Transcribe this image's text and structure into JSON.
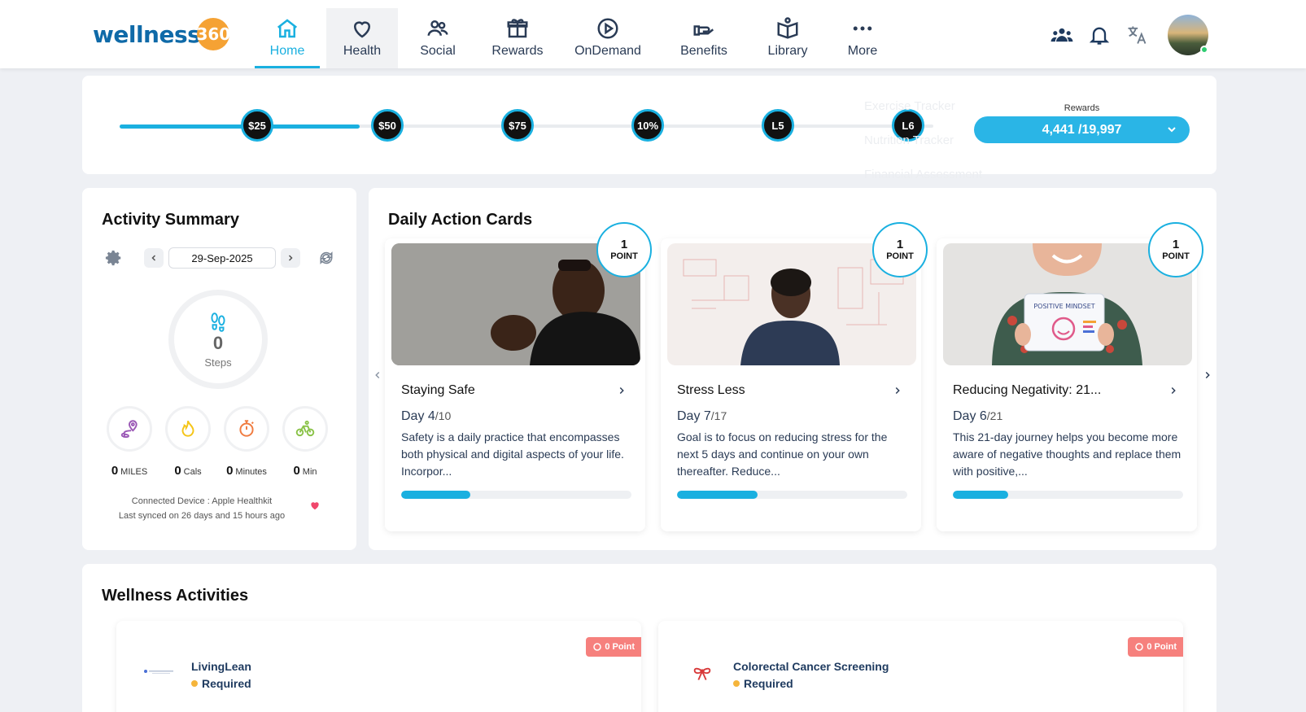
{
  "brand": {
    "name": "wellness",
    "number": "360"
  },
  "nav": {
    "items": [
      {
        "label": "Home",
        "icon": "home-icon"
      },
      {
        "label": "Health",
        "icon": "heart-icon"
      },
      {
        "label": "Social",
        "icon": "people-icon"
      },
      {
        "label": "Rewards",
        "icon": "gift-icon"
      },
      {
        "label": "OnDemand",
        "icon": "play-icon"
      },
      {
        "label": "Benefits",
        "icon": "hand-icon"
      },
      {
        "label": "Library",
        "icon": "book-icon"
      },
      {
        "label": "More",
        "icon": "dots-icon"
      }
    ],
    "active": "Home",
    "hovered": "Health"
  },
  "rewards": {
    "milestones": [
      "$25",
      "$50",
      "$75",
      "10%",
      "L5",
      "L6"
    ],
    "progress_fraction": 0.22,
    "label": "Rewards",
    "value": "4,441 /19,997",
    "menu_ghost": [
      "Exercise Tracker",
      "Nutrition Tracker",
      "Financial Assessment"
    ]
  },
  "activity": {
    "title": "Activity Summary",
    "date": "29-Sep-2025",
    "steps_value": "0",
    "steps_label": "Steps",
    "metrics": [
      {
        "value": "0",
        "unit": "MILES",
        "icon": "location-route-icon",
        "color": "#9b59b6"
      },
      {
        "value": "0",
        "unit": "Cals",
        "icon": "flame-icon",
        "color": "#f5c518"
      },
      {
        "value": "0",
        "unit": "Minutes",
        "icon": "stopwatch-icon",
        "color": "#f07b3f"
      },
      {
        "value": "0",
        "unit": "Min",
        "icon": "bike-icon",
        "color": "#8bc34a"
      }
    ],
    "connected_device": "Connected Device : Apple Healthkit",
    "last_synced": "Last synced on 26 days and 15 hours ago"
  },
  "daily": {
    "title": "Daily Action Cards",
    "cards": [
      {
        "points": "1",
        "points_label": "POINT",
        "title": "Staying Safe",
        "day_label": "Day 4",
        "day_total": "/10",
        "description": "Safety is a daily practice that encompasses both physical and digital aspects of your life. Incorpor...",
        "progress": 0.3
      },
      {
        "points": "1",
        "points_label": "POINT",
        "title": "Stress Less",
        "day_label": "Day 7",
        "day_total": "/17",
        "description": "Goal is to focus on reducing stress for the next 5 days and continue on your own thereafter. Reduce...",
        "progress": 0.35
      },
      {
        "points": "1",
        "points_label": "POINT",
        "title": "Reducing Negativity: 21...",
        "day_label": "Day 6",
        "day_total": "/21",
        "description": "This 21-day journey helps you become more aware of negative thoughts and replace them with positive,...",
        "progress": 0.24
      }
    ],
    "card3_sign": "POSITIVE MINDSET"
  },
  "wellness": {
    "title": "Wellness Activities",
    "items": [
      {
        "name": "LivingLean",
        "status": "Required",
        "badge": "0 Point"
      },
      {
        "name": "Colorectal Cancer Screening",
        "status": "Required",
        "badge": "0 Point"
      }
    ]
  },
  "colors": {
    "accent": "#1ab0e0",
    "brand": "#0f6aa8",
    "badge": "#f6807d"
  }
}
